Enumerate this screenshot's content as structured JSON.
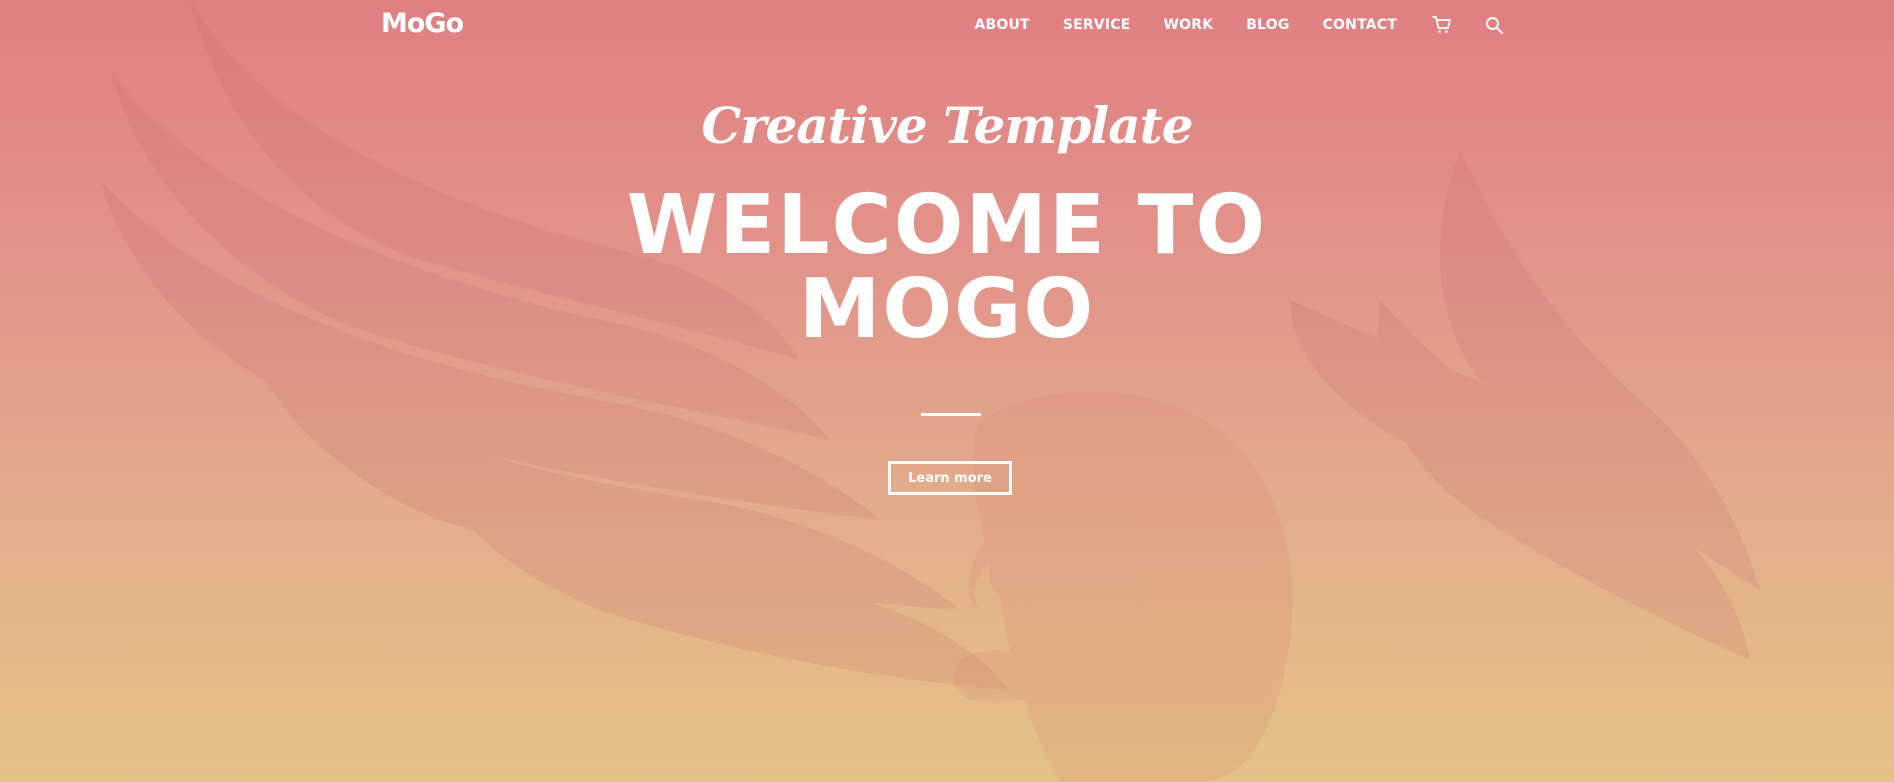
{
  "colors": {
    "gradient_top": "#e07f82",
    "gradient_bottom": "#e4c387",
    "text": "#ffffff"
  },
  "header": {
    "logo": "MoGo",
    "nav": [
      {
        "label": "ABOUT"
      },
      {
        "label": "SERVICE"
      },
      {
        "label": "WORK"
      },
      {
        "label": "BLOG"
      },
      {
        "label": "CONTACT"
      }
    ],
    "icons": [
      "cart-icon",
      "search-icon"
    ]
  },
  "hero": {
    "subtitle": "Creative Template",
    "title_line1": "WELCOME TO",
    "title_line2": "MOGO",
    "button_label": "Learn more",
    "background_icon": "eagle-illustration"
  }
}
